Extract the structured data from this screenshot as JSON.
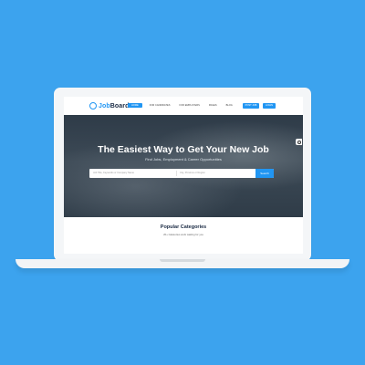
{
  "app": {
    "logo_prefix": "Job",
    "logo_suffix": "Board"
  },
  "nav": {
    "items": [
      "HOME",
      "FOR CANDIDATES",
      "FOR EMPLOYERS",
      "PAGES",
      "BLOG"
    ],
    "post_job": "POST JOB",
    "login": "LOGIN"
  },
  "hero": {
    "title": "The Easiest Way to Get Your New Job",
    "subtitle": "Find Jobs, Employment & Career Opportunities",
    "keyword_placeholder": "Job Title, Keywords or Company Name",
    "location_placeholder": "City, Province or Region",
    "search_label": "Search"
  },
  "popular": {
    "title": "Popular Categories",
    "subtitle": "20+ Catetories work waiting for you"
  },
  "colors": {
    "background": "#3ca3ee",
    "accent": "#2196f3",
    "navy": "#1b2b44"
  }
}
